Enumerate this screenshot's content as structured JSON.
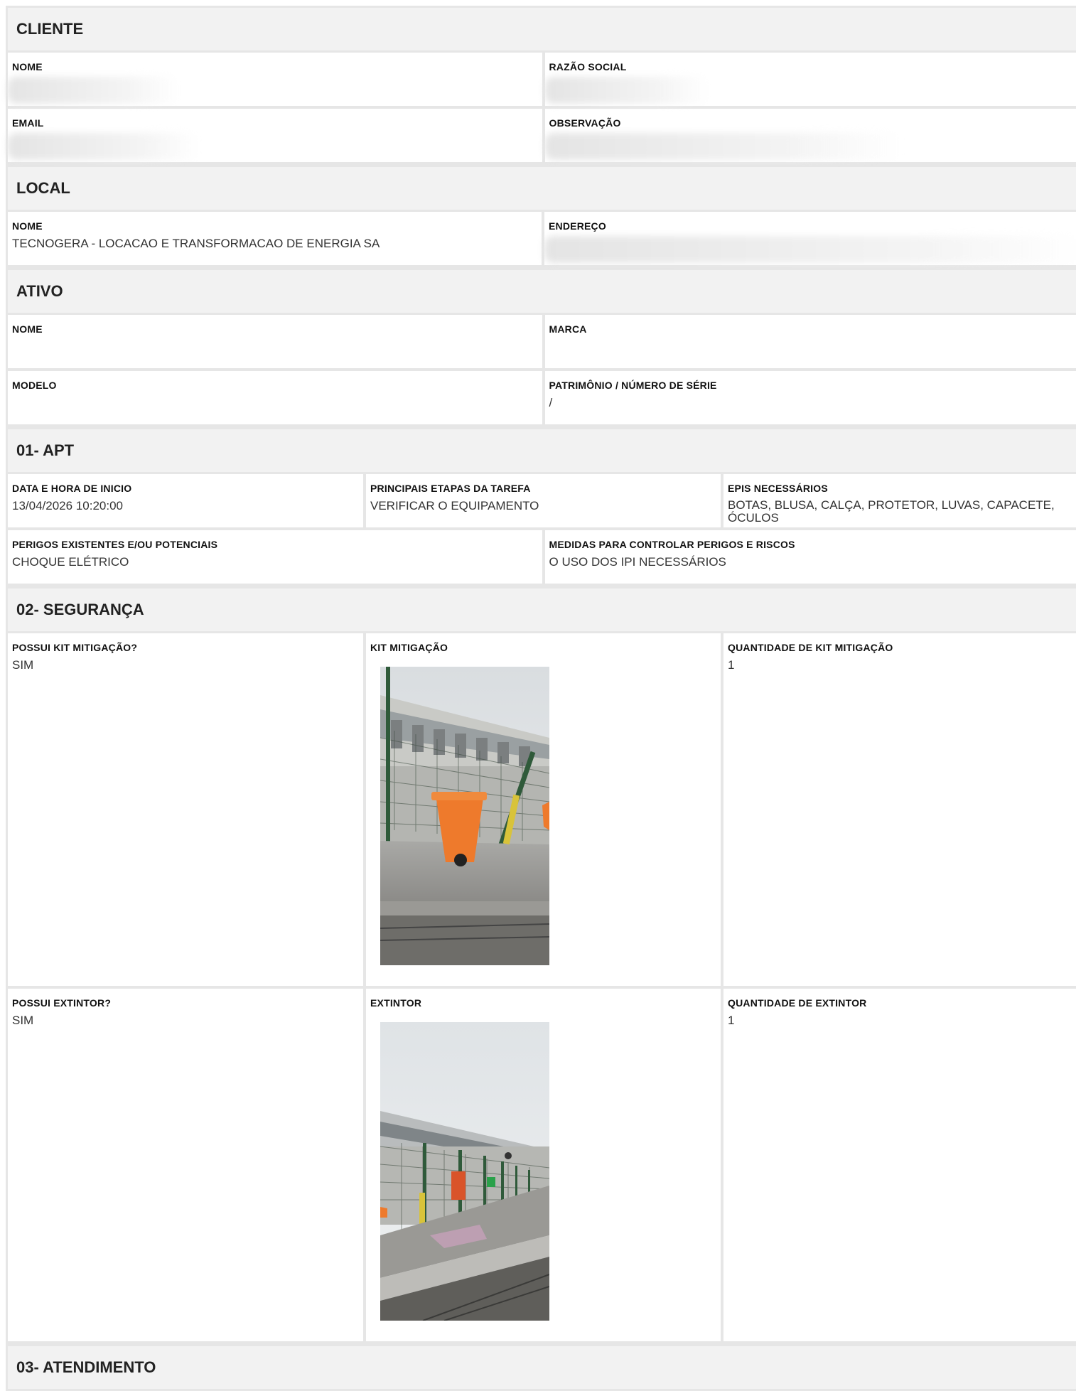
{
  "cliente": {
    "title": "CLIENTE",
    "nome_label": "NOME",
    "razao_label": "RAZÃO SOCIAL",
    "email_label": "EMAIL",
    "obs_label": "OBSERVAÇÃO"
  },
  "local": {
    "title": "LOCAL",
    "nome_label": "NOME",
    "nome_value": "TECNOGERA - LOCACAO E TRANSFORMACAO DE ENERGIA SA",
    "endereco_label": "ENDEREÇO"
  },
  "ativo": {
    "title": "ATIVO",
    "nome_label": "NOME",
    "marca_label": "MARCA",
    "modelo_label": "MODELO",
    "patrimonio_label": "PATRIMÔNIO / NÚMERO DE SÉRIE",
    "patrimonio_value": "/"
  },
  "apt": {
    "title": "01- APT",
    "data_label": "DATA E HORA DE INICIO",
    "data_value": "13/04/2026 10:20:00",
    "etapas_label": "PRINCIPAIS ETAPAS DA TAREFA",
    "etapas_value": "VERIFICAR O EQUIPAMENTO",
    "epis_label": "EPIS NECESSÁRIOS",
    "epis_value": "BOTAS, BLUSA, CALÇA, PROTETOR, LUVAS, CAPACETE, ÓCULOS",
    "perigos_label": "PERIGOS EXISTENTES E/OU POTENCIAIS",
    "perigos_value": "CHOQUE ELÉTRICO",
    "medidas_label": "MEDIDAS PARA CONTROLAR PERIGOS E RISCOS",
    "medidas_value": "O USO DOS IPI NECESSÁRIOS"
  },
  "seguranca": {
    "title": "02- SEGURANÇA",
    "kit_q_label": "POSSUI KIT MITIGAÇÃO?",
    "kit_q_value": "SIM",
    "kit_label": "KIT MITIGAÇÃO",
    "kit_qty_label": "QUANTIDADE DE KIT MITIGAÇÃO",
    "kit_qty_value": "1",
    "ext_q_label": "POSSUI EXTINTOR?",
    "ext_q_value": "SIM",
    "ext_label": "EXTINTOR",
    "ext_qty_label": "QUANTIDADE DE EXTINTOR",
    "ext_qty_value": "1"
  },
  "atendimento": {
    "title": "03- ATENDIMENTO"
  },
  "colors": {
    "section_bg": "#f2f2f2",
    "border": "#e6e6e6",
    "bin_orange": "#ee7a2c",
    "fence_green": "#2f5a3a"
  }
}
